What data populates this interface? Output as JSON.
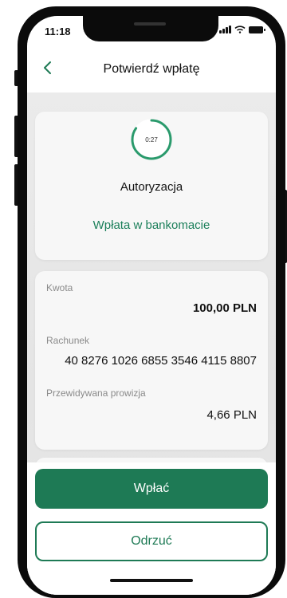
{
  "status_bar": {
    "time": "11:18",
    "icons": [
      "signal-icon",
      "wifi-icon",
      "battery-icon"
    ]
  },
  "header": {
    "title": "Potwierdź wpłatę",
    "back_icon": "chevron-left-icon"
  },
  "authorization": {
    "timer": "0:27",
    "title": "Autoryzacja",
    "subtitle": "Wpłata w bankomacie"
  },
  "details": [
    {
      "label": "Kwota",
      "value": "100,00 PLN"
    },
    {
      "label": "Rachunek",
      "value": "40 8276 1026 6855 3546 4115 8807"
    },
    {
      "label": "Przewidywana prowizja",
      "value": "4,66 PLN"
    }
  ],
  "actions": {
    "confirm_label": "Wpłać",
    "reject_label": "Odrzuć"
  },
  "colors": {
    "accent": "#1e7a55",
    "accent_text": "#1b7f5a",
    "background": "#e8e8e8"
  }
}
